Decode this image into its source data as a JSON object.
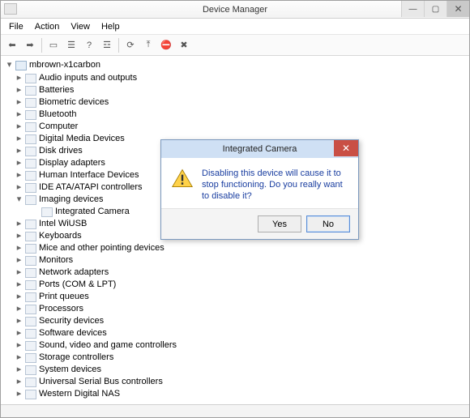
{
  "window": {
    "title": "Device Manager",
    "controls": {
      "min": "—",
      "max": "▢",
      "close": "✕"
    }
  },
  "menu": {
    "file": "File",
    "action": "Action",
    "view": "View",
    "help": "Help"
  },
  "toolbar": {
    "back": "⬅",
    "forward": "➡",
    "sep": "|",
    "show_hidden": "▭",
    "props": "☰",
    "help": "?",
    "list": "☲",
    "scan": "⟳",
    "uninstall": "✖",
    "update": "⤒",
    "disable": "⛔"
  },
  "tree": {
    "root": "mbrown-x1carbon",
    "nodes": [
      {
        "label": "Audio inputs and outputs"
      },
      {
        "label": "Batteries"
      },
      {
        "label": "Biometric devices"
      },
      {
        "label": "Bluetooth"
      },
      {
        "label": "Computer"
      },
      {
        "label": "Digital Media Devices"
      },
      {
        "label": "Disk drives"
      },
      {
        "label": "Display adapters"
      },
      {
        "label": "Human Interface Devices"
      },
      {
        "label": "IDE ATA/ATAPI controllers"
      },
      {
        "label": "Imaging devices",
        "expanded": true,
        "children": [
          {
            "label": "Integrated Camera"
          }
        ]
      },
      {
        "label": "Intel WiUSB"
      },
      {
        "label": "Keyboards"
      },
      {
        "label": "Mice and other pointing devices"
      },
      {
        "label": "Monitors"
      },
      {
        "label": "Network adapters"
      },
      {
        "label": "Ports (COM & LPT)"
      },
      {
        "label": "Print queues"
      },
      {
        "label": "Processors"
      },
      {
        "label": "Security devices"
      },
      {
        "label": "Software devices"
      },
      {
        "label": "Sound, video and game controllers"
      },
      {
        "label": "Storage controllers"
      },
      {
        "label": "System devices"
      },
      {
        "label": "Universal Serial Bus controllers"
      },
      {
        "label": "Western Digital NAS"
      }
    ]
  },
  "dialog": {
    "title": "Integrated Camera",
    "message": "Disabling this device will cause it to stop functioning. Do you really want to disable it?",
    "yes": "Yes",
    "no": "No",
    "close": "✕"
  }
}
